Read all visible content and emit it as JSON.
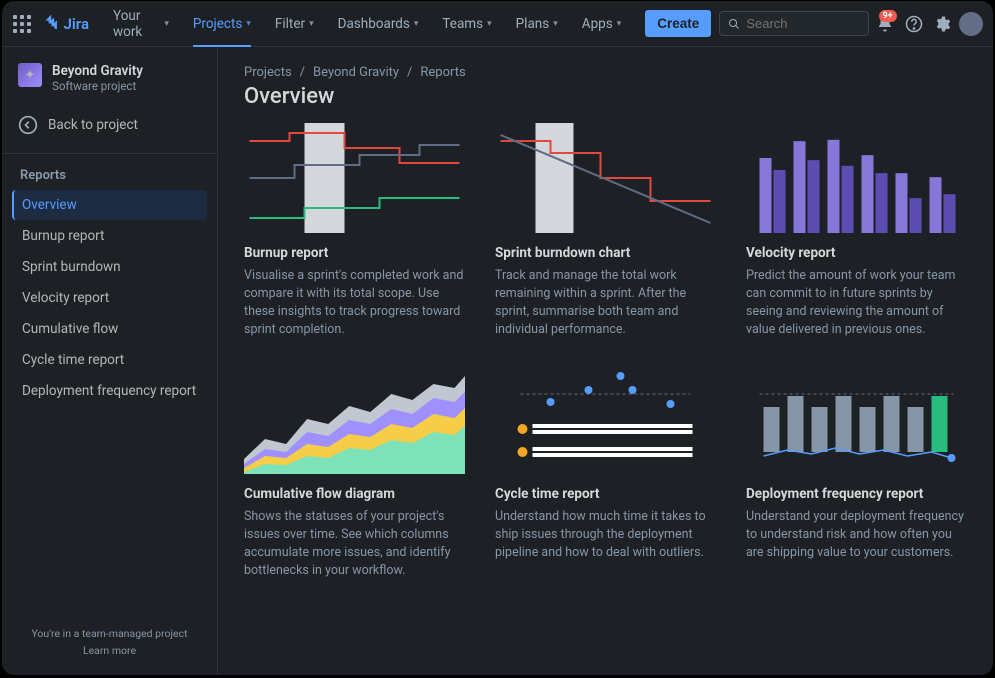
{
  "brand": "Jira",
  "nav": {
    "items": [
      {
        "label": "Your work"
      },
      {
        "label": "Projects",
        "active": true
      },
      {
        "label": "Filter"
      },
      {
        "label": "Dashboards"
      },
      {
        "label": "Teams"
      },
      {
        "label": "Plans"
      },
      {
        "label": "Apps"
      }
    ],
    "create_label": "Create",
    "search_placeholder": "Search",
    "notif_count": "9+"
  },
  "project": {
    "name": "Beyond Gravity",
    "subtitle": "Software project",
    "back_label": "Back to project"
  },
  "sidebar": {
    "heading": "Reports",
    "items": [
      {
        "label": "Overview",
        "selected": true
      },
      {
        "label": "Burnup report"
      },
      {
        "label": "Sprint burndown"
      },
      {
        "label": "Velocity report"
      },
      {
        "label": "Cumulative flow"
      },
      {
        "label": "Cycle time report"
      },
      {
        "label": "Deployment frequency report"
      }
    ],
    "footer_line": "You're in a team-managed project",
    "footer_link": "Learn more"
  },
  "breadcrumb": [
    "Projects",
    "Beyond Gravity",
    "Reports"
  ],
  "page_title": "Overview",
  "cards": [
    {
      "title": "Burnup report",
      "desc": "Visualise a sprint's completed work and compare it with its total scope. Use these insights to track progress toward sprint completion."
    },
    {
      "title": "Sprint burndown chart",
      "desc": "Track and manage the total work remaining within a sprint. After the sprint, summarise both team and individual performance."
    },
    {
      "title": "Velocity report",
      "desc": "Predict the amount of work your team can commit to in future sprints by seeing and reviewing the amount of value delivered in previous ones."
    },
    {
      "title": "Cumulative flow diagram",
      "desc": "Shows the statuses of your project's issues over time. See which columns accumulate more issues, and identify bottlenecks in your workflow."
    },
    {
      "title": "Cycle time report",
      "desc": "Understand how much time it takes to ship issues through the deployment pipeline and how to deal with outliers."
    },
    {
      "title": "Deployment frequency report",
      "desc": "Understand your deployment frequency to understand risk and how often you are shipping value to your customers."
    }
  ],
  "colors": {
    "accent": "#579dff",
    "green": "#2abb7f",
    "orange": "#f5a623",
    "red": "#e2483d",
    "purple": "#8777d9",
    "yellow": "#f5cd47",
    "lightgreen": "#7ee2b8",
    "gray": "#8696a7"
  }
}
